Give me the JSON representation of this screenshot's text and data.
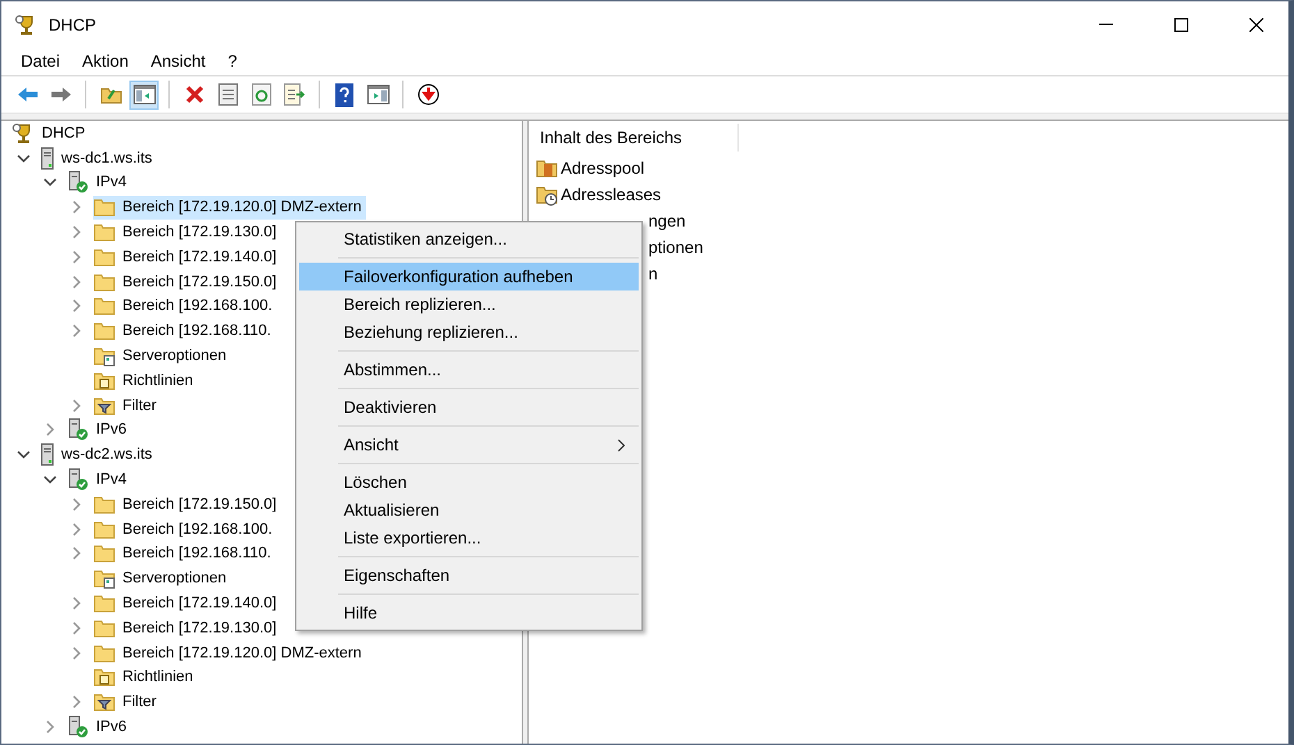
{
  "window": {
    "title": "DHCP"
  },
  "menu_bar": [
    "Datei",
    "Aktion",
    "Ansicht",
    "?"
  ],
  "toolbar": [
    {
      "kind": "back",
      "pressed": false
    },
    {
      "kind": "forward",
      "pressed": false
    },
    {
      "kind": "separator"
    },
    {
      "kind": "up",
      "pressed": false
    },
    {
      "kind": "tree",
      "pressed": true
    },
    {
      "kind": "separator"
    },
    {
      "kind": "delete",
      "pressed": false
    },
    {
      "kind": "properties",
      "pressed": false
    },
    {
      "kind": "refresh",
      "pressed": false
    },
    {
      "kind": "export",
      "pressed": false
    },
    {
      "kind": "separator"
    },
    {
      "kind": "help",
      "pressed": false
    },
    {
      "kind": "pane",
      "pressed": false
    },
    {
      "kind": "separator"
    },
    {
      "kind": "stop",
      "pressed": false
    }
  ],
  "tree": [
    {
      "label": "DHCP",
      "kind": "dhcp",
      "selected": false,
      "children": [
        {
          "label": "ws-dc1.ws.its",
          "kind": "server",
          "selected": false,
          "expanded": true,
          "children": [
            {
              "label": "IPv4",
              "kind": "ipv",
              "selected": false,
              "expanded": true,
              "children": [
                {
                  "label": "Bereich [172.19.120.0] DMZ-extern",
                  "kind": "folder",
                  "selected": true,
                  "expanded": false
                },
                {
                  "label": "Bereich [172.19.130.0]",
                  "kind": "folder",
                  "selected": false,
                  "expanded": false
                },
                {
                  "label": "Bereich [172.19.140.0]",
                  "kind": "folder",
                  "selected": false,
                  "expanded": false
                },
                {
                  "label": "Bereich [172.19.150.0]",
                  "kind": "folder",
                  "selected": false,
                  "expanded": false
                },
                {
                  "label": "Bereich [192.168.100.",
                  "kind": "folder",
                  "selected": false,
                  "expanded": false
                },
                {
                  "label": "Bereich [192.168.110.",
                  "kind": "folder",
                  "selected": false,
                  "expanded": false
                },
                {
                  "label": "Serveroptionen",
                  "kind": "options",
                  "selected": false
                },
                {
                  "label": "Richtlinien",
                  "kind": "policies",
                  "selected": false
                },
                {
                  "label": "Filter",
                  "kind": "filter",
                  "selected": false,
                  "expanded": false
                }
              ]
            },
            {
              "label": "IPv6",
              "kind": "ipv",
              "selected": false,
              "expanded": false
            }
          ]
        },
        {
          "label": "ws-dc2.ws.its",
          "kind": "server",
          "selected": false,
          "expanded": true,
          "children": [
            {
              "label": "IPv4",
              "kind": "ipv",
              "selected": false,
              "expanded": true,
              "children": [
                {
                  "label": "Bereich [172.19.150.0]",
                  "kind": "folder",
                  "selected": false,
                  "expanded": false
                },
                {
                  "label": "Bereich [192.168.100.",
                  "kind": "folder",
                  "selected": false,
                  "expanded": false
                },
                {
                  "label": "Bereich [192.168.110.",
                  "kind": "folder",
                  "selected": false,
                  "expanded": false
                },
                {
                  "label": "Serveroptionen",
                  "kind": "options",
                  "selected": false
                },
                {
                  "label": "Bereich [172.19.140.0]",
                  "kind": "folder",
                  "selected": false,
                  "expanded": false
                },
                {
                  "label": "Bereich [172.19.130.0]",
                  "kind": "folder",
                  "selected": false,
                  "expanded": false
                },
                {
                  "label": "Bereich [172.19.120.0] DMZ-extern",
                  "kind": "folder",
                  "selected": false,
                  "expanded": false
                },
                {
                  "label": "Richtlinien",
                  "kind": "policies",
                  "selected": false
                },
                {
                  "label": "Filter",
                  "kind": "filter",
                  "selected": false,
                  "expanded": false
                }
              ]
            },
            {
              "label": "IPv6",
              "kind": "ipv",
              "selected": false,
              "expanded": false
            }
          ]
        }
      ]
    }
  ],
  "content": {
    "column_1": "Inhalt des Bereichs",
    "items": [
      {
        "kind": "pool",
        "label": "Adresspool"
      },
      {
        "kind": "leases",
        "label": "Adressleases"
      },
      {
        "kind": "covered",
        "label": "ngen"
      },
      {
        "kind": "covered",
        "label": "ptionen"
      },
      {
        "kind": "covered",
        "label": "n"
      }
    ]
  },
  "context_menu": {
    "groups": [
      [
        {
          "label": "Statistiken anzeigen...",
          "selected": false,
          "submenu": false
        }
      ],
      [
        {
          "label": "Failoverkonfiguration aufheben",
          "selected": true,
          "submenu": false
        },
        {
          "label": "Bereich replizieren...",
          "selected": false,
          "submenu": false
        },
        {
          "label": "Beziehung replizieren...",
          "selected": false,
          "submenu": false
        }
      ],
      [
        {
          "label": "Abstimmen...",
          "selected": false,
          "submenu": false
        }
      ],
      [
        {
          "label": "Deaktivieren",
          "selected": false,
          "submenu": false
        }
      ],
      [
        {
          "label": "Ansicht",
          "selected": false,
          "submenu": true
        }
      ],
      [
        {
          "label": "Löschen",
          "selected": false,
          "submenu": false
        },
        {
          "label": "Aktualisieren",
          "selected": false,
          "submenu": false
        },
        {
          "label": "Liste exportieren...",
          "selected": false,
          "submenu": false
        }
      ],
      [
        {
          "label": "Eigenschaften",
          "selected": false,
          "submenu": false
        }
      ],
      [
        {
          "label": "Hilfe",
          "selected": false,
          "submenu": false
        }
      ]
    ]
  }
}
